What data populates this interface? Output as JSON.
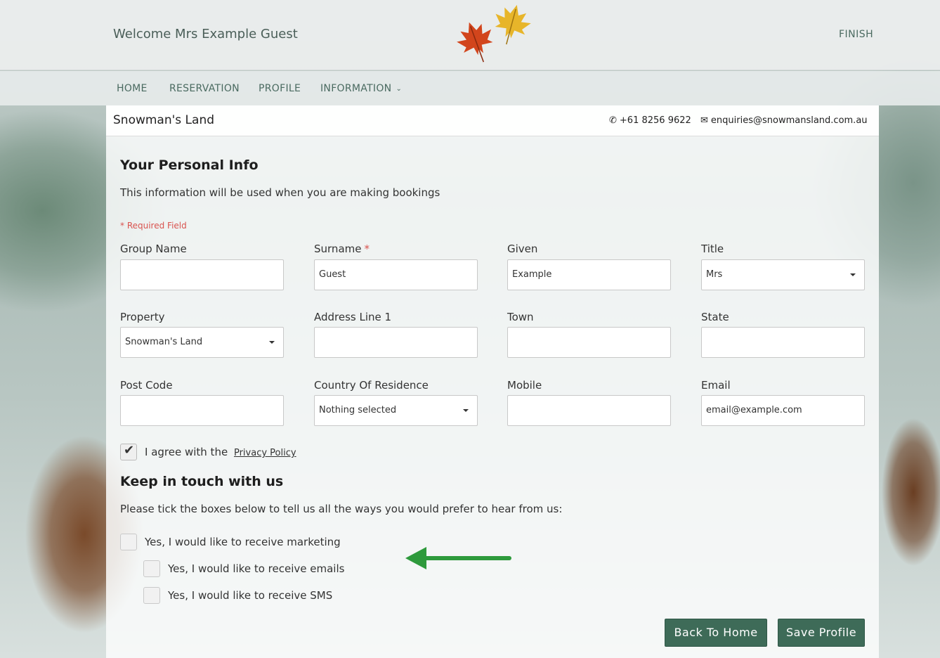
{
  "header": {
    "welcome": "Welcome Mrs Example Guest",
    "finish": "FINISH"
  },
  "nav": {
    "items": [
      {
        "label": "HOME"
      },
      {
        "label": "RESERVATION"
      },
      {
        "label": "PROFILE"
      },
      {
        "label": "INFORMATION"
      }
    ]
  },
  "property_bar": {
    "name": "Snowman's Land",
    "phone": "+61 8256 9622",
    "email": "enquiries@snowmansland.com.au"
  },
  "form": {
    "title": "Your Personal Info",
    "subtitle": "This information will be used when you are making bookings",
    "required_note": "* Required Field",
    "fields": {
      "group_name": {
        "label": "Group Name",
        "value": ""
      },
      "surname": {
        "label": "Surname",
        "required_mark": "*",
        "value": "Guest"
      },
      "given": {
        "label": "Given",
        "value": "Example"
      },
      "title": {
        "label": "Title",
        "value": "Mrs"
      },
      "property": {
        "label": "Property",
        "value": "Snowman's Land"
      },
      "address1": {
        "label": "Address Line 1",
        "value": ""
      },
      "town": {
        "label": "Town",
        "value": ""
      },
      "state": {
        "label": "State",
        "value": ""
      },
      "post_code": {
        "label": "Post Code",
        "value": ""
      },
      "country": {
        "label": "Country Of Residence",
        "value": "Nothing selected"
      },
      "mobile": {
        "label": "Mobile",
        "value": ""
      },
      "email": {
        "label": "Email",
        "value": "email@example.com"
      }
    },
    "privacy": {
      "text": "I agree with the",
      "link": "Privacy Policy",
      "checked": true
    }
  },
  "keep_in_touch": {
    "title": "Keep in touch with us",
    "subtitle": "Please tick the boxes below to tell us all the ways you would prefer to hear from us:",
    "options": [
      {
        "label": "Yes, I would like to receive marketing",
        "checked": false
      },
      {
        "label": "Yes, I would like to receive emails",
        "checked": false
      },
      {
        "label": "Yes, I would like to receive SMS",
        "checked": false
      }
    ]
  },
  "buttons": {
    "back": "Back To Home",
    "save": "Save Profile"
  },
  "colors": {
    "primary_button": "#3e6b58",
    "nav_text": "#4a6a60",
    "required": "#d9534f",
    "arrow": "#2e9a3c"
  },
  "icons": [
    "maple-leaf-logo-icon",
    "phone-icon",
    "envelope-icon",
    "chevron-down-icon",
    "checkmark-icon",
    "green-arrow-icon"
  ]
}
